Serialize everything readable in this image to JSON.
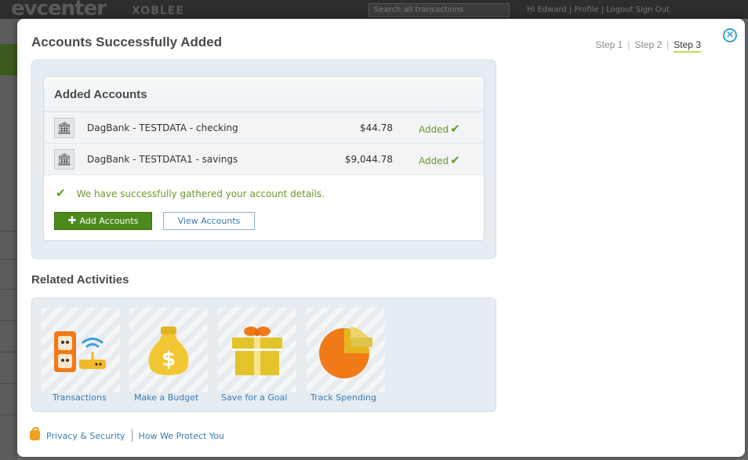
{
  "background": {
    "logo": "evcenter",
    "brand": "XOBLEE",
    "search_placeholder": "Search all transactions",
    "nav": "Hi Edward  |  Profile  |  Logout  Sign Out"
  },
  "modal": {
    "title": "Accounts Successfully Added",
    "steps": [
      "Step 1",
      "Step 2",
      "Step 3"
    ],
    "active_step": "Step 3",
    "close_icon": "close-circle-icon"
  },
  "accounts": {
    "heading": "Added Accounts",
    "rows": [
      {
        "name": "DagBank - TESTDATA - checking",
        "amount": "$44.78",
        "status": "Added"
      },
      {
        "name": "DagBank - TESTDATA1 - savings",
        "amount": "$9,044.78",
        "status": "Added"
      }
    ],
    "success_message": "We have successfully gathered your account details.",
    "add_button": "Add Accounts",
    "view_button": "View Accounts"
  },
  "related": {
    "title": "Related Activities",
    "items": [
      {
        "label": "Transactions",
        "icon": "outlet-wifi-icon"
      },
      {
        "label": "Make a Budget",
        "icon": "money-bag-icon"
      },
      {
        "label": "Save for a Goal",
        "icon": "gift-icon"
      },
      {
        "label": "Track Spending",
        "icon": "pie-chart-icon"
      }
    ]
  },
  "footer": {
    "privacy_link": "Privacy & Security",
    "protect_link": "How We Protect You"
  },
  "colors": {
    "accent_green": "#4d8a1c",
    "link_blue": "#3a7ab0",
    "success_green": "#6a9a2a",
    "close_blue": "#3aa0d8"
  }
}
